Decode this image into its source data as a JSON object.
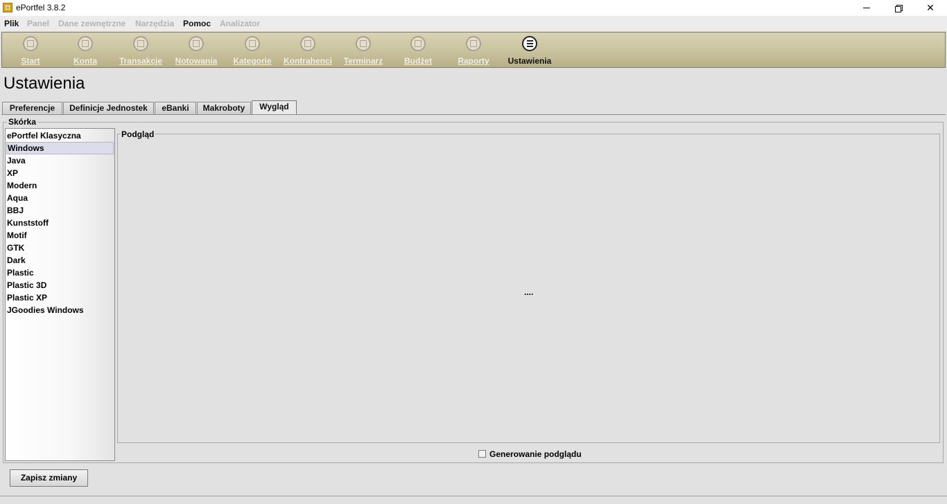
{
  "window": {
    "title": "ePortfel 3.8.2"
  },
  "menu": {
    "items": [
      {
        "label": "Plik",
        "enabled": true
      },
      {
        "label": "Panel",
        "enabled": false
      },
      {
        "label": "Dane zewnętrzne",
        "enabled": false
      },
      {
        "label": "Narzędzia",
        "enabled": false
      },
      {
        "label": "Pomoc",
        "enabled": true
      },
      {
        "label": "Analizator",
        "enabled": false
      }
    ]
  },
  "toolbar": {
    "buttons": [
      {
        "label": "Start",
        "icon": "start-icon"
      },
      {
        "label": "Konta",
        "icon": "accounts-icon"
      },
      {
        "label": "Transakcje",
        "icon": "transactions-icon"
      },
      {
        "label": "Notowania",
        "icon": "quotes-icon"
      },
      {
        "label": "Kategorie",
        "icon": "categories-icon"
      },
      {
        "label": "Kontrahenci",
        "icon": "contractors-icon"
      },
      {
        "label": "Terminarz",
        "icon": "calendar-icon"
      },
      {
        "label": "Budżet",
        "icon": "budget-icon"
      },
      {
        "label": "Raporty",
        "icon": "reports-icon"
      },
      {
        "label": "Ustawienia",
        "icon": "settings-list-icon",
        "active": true
      }
    ]
  },
  "page": {
    "title": "Ustawienia"
  },
  "tabs": [
    {
      "label": "Preferencje"
    },
    {
      "label": "Definicje Jednostek"
    },
    {
      "label": "eBanki"
    },
    {
      "label": "Makroboty"
    },
    {
      "label": "Wygląd",
      "selected": true
    }
  ],
  "skin_group": {
    "label": "Skórka",
    "items": [
      "ePortfel Klasyczna",
      "Windows",
      "Java",
      "XP",
      "Modern",
      "Aqua",
      "BBJ",
      "Kunststoff",
      "Motif",
      "GTK",
      "Dark",
      "Plastic",
      "Plastic 3D",
      "Plastic XP",
      "JGoodies Windows"
    ],
    "selected": "Windows"
  },
  "preview": {
    "label": "Podgląd",
    "content": "...."
  },
  "generate_preview": {
    "label": "Generowanie podglądu",
    "checked": false
  },
  "save_button": {
    "label": "Zapisz zmiany"
  }
}
